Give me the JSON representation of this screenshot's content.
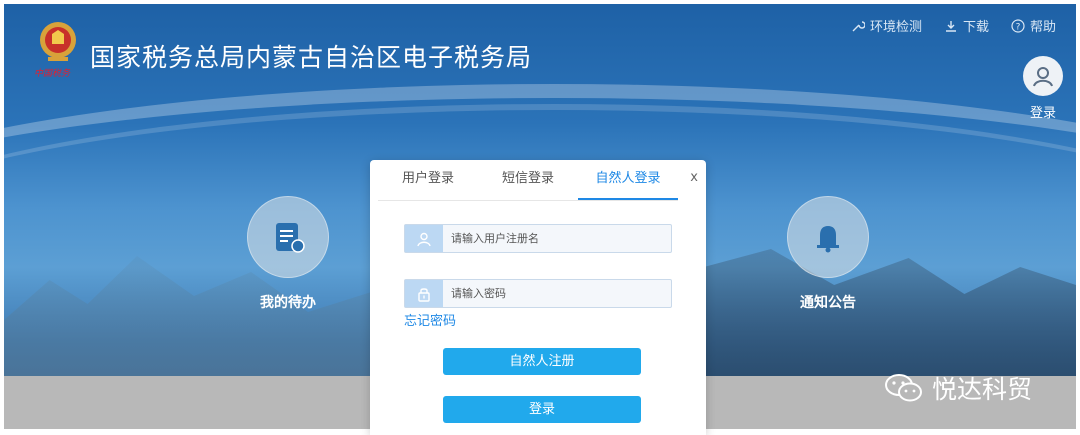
{
  "header": {
    "title": "国家税务总局内蒙古自治区电子税务局",
    "emblem_text": "中国税务",
    "utility_nav": [
      {
        "label": "环境检测",
        "icon": "wrench-icon"
      },
      {
        "label": "下载",
        "icon": "download-icon"
      },
      {
        "label": "帮助",
        "icon": "help-icon"
      }
    ],
    "login_label": "登录"
  },
  "features": [
    {
      "label": "我的待办",
      "icon": "todo-document-icon"
    },
    {
      "label": "通知公告",
      "icon": "bell-icon"
    }
  ],
  "modal": {
    "tabs": [
      {
        "label": "用户登录",
        "active": false
      },
      {
        "label": "短信登录",
        "active": false
      },
      {
        "label": "自然人登录",
        "active": true
      }
    ],
    "close_label": "x",
    "username_placeholder": "请输入用户注册名",
    "password_placeholder": "请输入密码",
    "forgot_label": "忘记密码",
    "register_button": "自然人注册",
    "login_button": "登录"
  },
  "watermark": {
    "text": "悦达科贸",
    "icon": "wechat-icon"
  },
  "colors": {
    "accent": "#1e88e5",
    "button": "#21a9ec",
    "header_bg": "#1e61a6"
  }
}
